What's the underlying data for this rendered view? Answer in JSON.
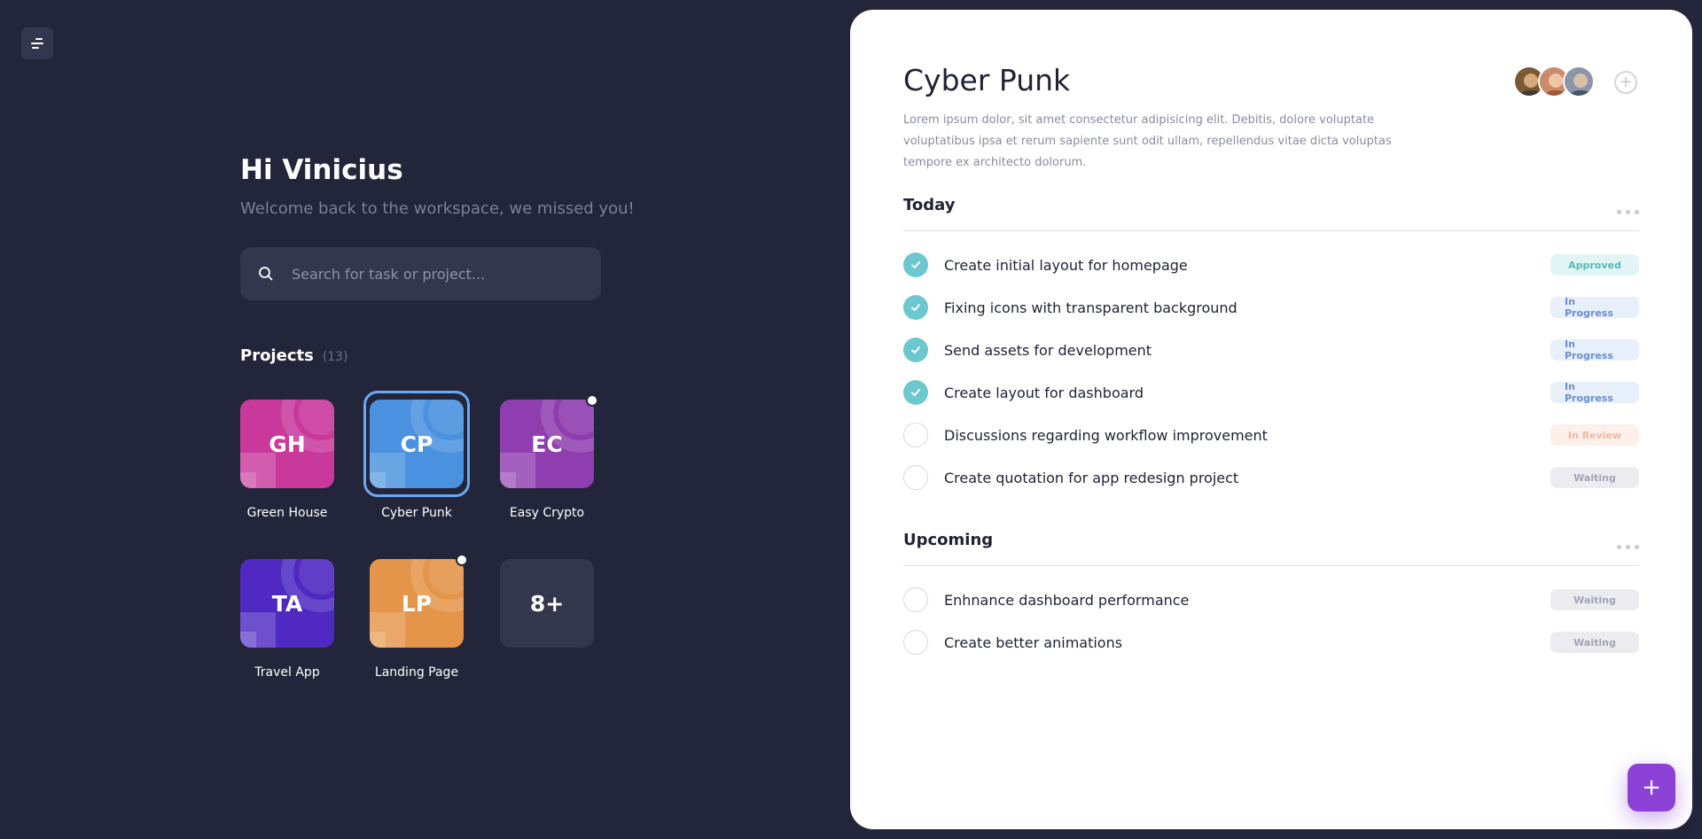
{
  "greeting": "Hi Vinicius",
  "subtitle": "Welcome back to the workspace, we missed you!",
  "search": {
    "placeholder": "Search for task or project..."
  },
  "projects": {
    "label": "Projects",
    "count": "(13)",
    "items": [
      {
        "initials": "GH",
        "name": "Green House",
        "color": "#c9399c"
      },
      {
        "initials": "CP",
        "name": "Cyber Punk",
        "color": "#4a92df"
      },
      {
        "initials": "EC",
        "name": "Easy Crypto",
        "color": "#8f3eaf"
      },
      {
        "initials": "TA",
        "name": "Travel App",
        "color": "#4f29c2"
      },
      {
        "initials": "LP",
        "name": "Landing Page",
        "color": "#e4954a"
      },
      {
        "initials": "8+",
        "name": ""
      }
    ]
  },
  "detail": {
    "title": "Cyber Punk",
    "description": "Lorem ipsum dolor, sit amet consectetur adipisicing elit. Debitis, dolore voluptate voluptatibus ipsa et rerum sapiente sunt odit ullam, repellendus vitae dicta voluptas tempore ex architecto dolorum.",
    "add_member": "+",
    "today": {
      "label": "Today",
      "tasks": [
        {
          "text": "Create initial layout for homepage",
          "status": "Approved"
        },
        {
          "text": "Fixing icons with transparent background",
          "status": "In Progress"
        },
        {
          "text": "Send assets for development",
          "status": "In Progress"
        },
        {
          "text": "Create layout for dashboard",
          "status": "In Progress"
        },
        {
          "text": "Discussions regarding workflow improvement",
          "status": "In Review"
        },
        {
          "text": "Create quotation for app redesign project",
          "status": "Waiting"
        }
      ]
    },
    "upcoming": {
      "label": "Upcoming",
      "tasks": [
        {
          "text": "Enhnance dashboard performance",
          "status": "Waiting"
        },
        {
          "text": "Create better animations",
          "status": "Waiting"
        }
      ]
    }
  },
  "fab": {
    "label": "+"
  },
  "colors": {
    "background": "#23253a",
    "surface": "#33364c",
    "accent": "#8b41d6",
    "check": "#6cc8ce"
  }
}
